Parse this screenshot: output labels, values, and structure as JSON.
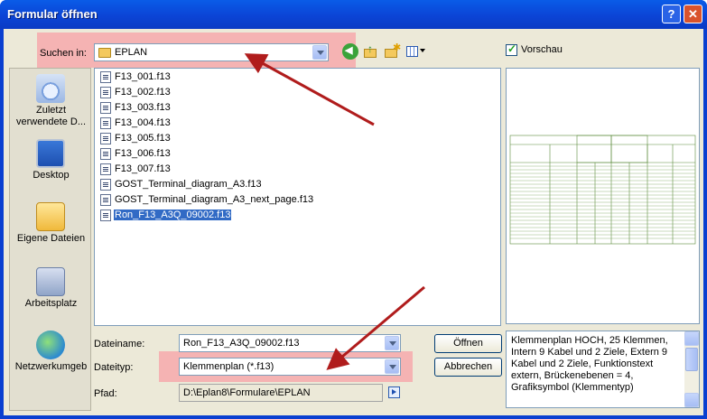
{
  "window": {
    "title": "Formular öffnen"
  },
  "lookin": {
    "label": "Suchen in:",
    "value": "EPLAN"
  },
  "preview_checkbox": {
    "label": "Vorschau",
    "checked": true
  },
  "places": [
    {
      "label": "Zuletzt verwendete D..."
    },
    {
      "label": "Desktop"
    },
    {
      "label": "Eigene Dateien"
    },
    {
      "label": "Arbeitsplatz"
    },
    {
      "label": "Netzwerkumgeb"
    }
  ],
  "files": [
    "F13_001.f13",
    "F13_002.f13",
    "F13_003.f13",
    "F13_004.f13",
    "F13_005.f13",
    "F13_006.f13",
    "F13_007.f13",
    "GOST_Terminal_diagram_A3.f13",
    "GOST_Terminal_diagram_A3_next_page.f13",
    "Ron_F13_A3Q_09002.f13"
  ],
  "selected_file": "Ron_F13_A3Q_09002.f13",
  "filename": {
    "label": "Dateiname:",
    "value": "Ron_F13_A3Q_09002.f13"
  },
  "filetype": {
    "label": "Dateityp:",
    "value": "Klemmenplan (*.f13)"
  },
  "path": {
    "label": "Pfad:",
    "value": "D:\\Eplan8\\Formulare\\EPLAN"
  },
  "buttons": {
    "open": "Öffnen",
    "cancel": "Abbrechen"
  },
  "description": "Klemmenplan HOCH, 25 Klemmen, Intern 9 Kabel und 2 Ziele, Extern 9 Kabel und 2 Ziele, Funktionstext extern, Brückenebenen = 4, Grafiksymbol (Klemmentyp)",
  "colors": {
    "title_bar": "#0b44d6",
    "highlight": "#f5b3b3",
    "arrow": "#b01c1c",
    "selection": "#316ac5",
    "preview_lines": "#5a8a3a"
  }
}
